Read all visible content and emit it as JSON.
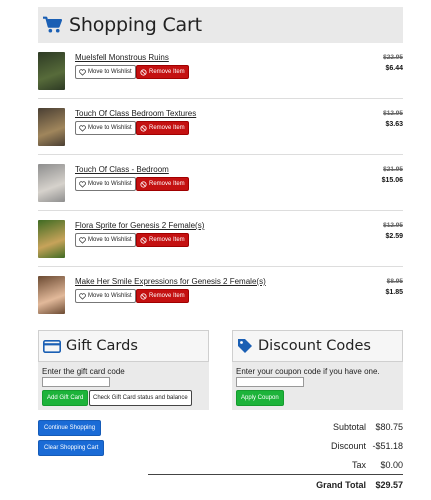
{
  "header": {
    "title": "Shopping Cart",
    "icon": "shopping-cart-icon",
    "icon_color": "#1a5fb4"
  },
  "items": [
    {
      "name": "Muelsfell Monstrous Ruins",
      "wishlist_label": "Move to Wishlist",
      "remove_label": "Remove Item",
      "old_price": "$22.95",
      "new_price": "$6.44",
      "thumb_colors": [
        "#2d3a24",
        "#576b3a"
      ]
    },
    {
      "name": "Touch Of Class Bedroom Textures",
      "wishlist_label": "Move to Wishlist",
      "remove_label": "Remove Item",
      "old_price": "$12.95",
      "new_price": "$3.63",
      "thumb_colors": [
        "#4a3f33",
        "#a0865c"
      ]
    },
    {
      "name": "Touch Of Class - Bedroom",
      "wishlist_label": "Move to Wishlist",
      "remove_label": "Remove Item",
      "old_price": "$21.95",
      "new_price": "$15.06",
      "thumb_colors": [
        "#8e8e8e",
        "#d6d2cc"
      ]
    },
    {
      "name": "Flora Sprite for Genesis 2 Female(s)",
      "wishlist_label": "Move to Wishlist",
      "remove_label": "Remove Item",
      "old_price": "$12.95",
      "new_price": "$2.59",
      "thumb_colors": [
        "#3f6b23",
        "#c7a35a"
      ]
    },
    {
      "name": "Make Her Smile Expressions for Genesis 2 Female(s)",
      "wishlist_label": "Move to Wishlist",
      "remove_label": "Remove Item",
      "old_price": "$8.95",
      "new_price": "$1.85",
      "thumb_colors": [
        "#6b4a32",
        "#e2b99a"
      ]
    }
  ],
  "gift_cards": {
    "title": "Gift Cards",
    "hint": "Enter the gift card code",
    "value": "",
    "add_label": "Add Gift Card",
    "check_label": "Check Gift Card status and balance"
  },
  "discount": {
    "title": "Discount Codes",
    "hint": "Enter your coupon code if you have one.",
    "value": "",
    "apply_label": "Apply Coupon"
  },
  "actions": {
    "continue_label": "Continue Shopping",
    "clear_label": "Clear Shopping Cart"
  },
  "totals": {
    "subtotal_label": "Subtotal",
    "subtotal": "$80.75",
    "discount_label": "Discount",
    "discount": "-$51.18",
    "tax_label": "Tax",
    "tax": "$0.00",
    "grand_label": "Grand Total",
    "grand": "$29.57"
  },
  "colors": {
    "remove": "#c41111",
    "green": "#1db33a",
    "blue": "#1a6bd6"
  }
}
